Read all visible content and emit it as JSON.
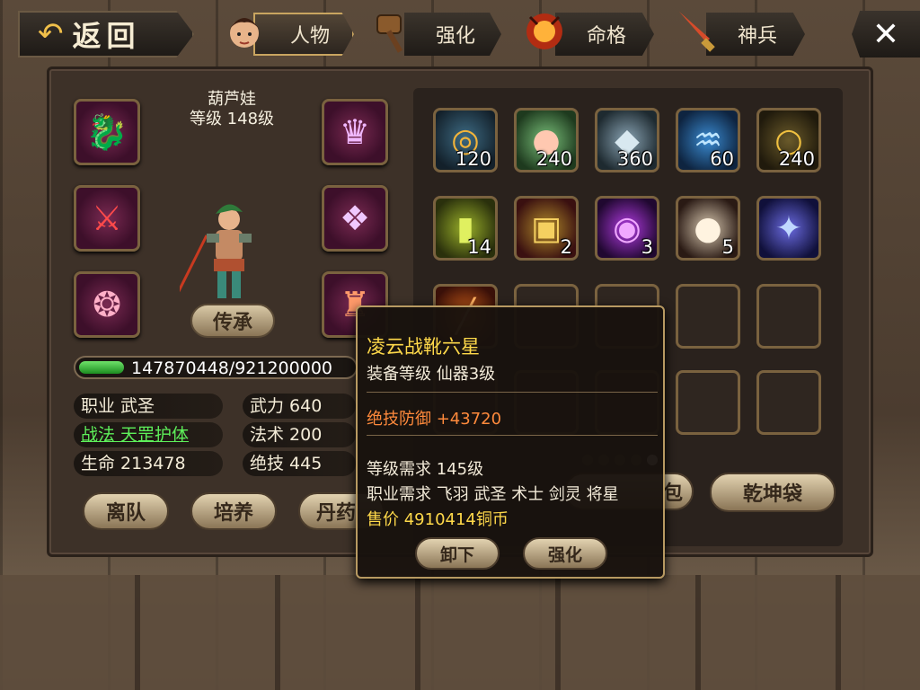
{
  "nav": {
    "back_label": "返回",
    "close_icon": "✕",
    "tabs": [
      {
        "label": "人物",
        "icon": "hero-portrait-icon",
        "active": true
      },
      {
        "label": "强化",
        "icon": "hammer-icon",
        "active": false
      },
      {
        "label": "命格",
        "icon": "demon-mask-icon",
        "active": false
      },
      {
        "label": "神兵",
        "icon": "sword-icon",
        "active": false
      }
    ]
  },
  "hero": {
    "name": "葫芦娃",
    "level_text": "等级 148级",
    "inherit_label": "传承",
    "exp_text": "147870448/921200000",
    "exp_fraction": 0.16,
    "stats_left": [
      {
        "text": "职业 武圣",
        "highlight": false
      },
      {
        "text": "战法 天罡护体",
        "highlight": true
      },
      {
        "text": "生命 213478",
        "highlight": false
      }
    ],
    "stats_right": [
      {
        "text": "武力 640"
      },
      {
        "text": "法术 200"
      },
      {
        "text": "绝技 445"
      }
    ],
    "buttons": [
      "离队",
      "培养",
      "丹药"
    ]
  },
  "equipment": [
    {
      "slot": "left-1",
      "icon": "white-beast-icon"
    },
    {
      "slot": "left-2",
      "icon": "red-blade-icon"
    },
    {
      "slot": "left-3",
      "icon": "pendant-icon"
    },
    {
      "slot": "right-1",
      "icon": "helmet-icon"
    },
    {
      "slot": "right-2",
      "icon": "armor-icon"
    },
    {
      "slot": "right-3",
      "icon": "boots-icon"
    }
  ],
  "bag": {
    "rows": [
      [
        {
          "icon": "gold-coin-icon",
          "count": "120"
        },
        {
          "icon": "peach-icon",
          "count": "240"
        },
        {
          "icon": "stone-icon",
          "count": "360"
        },
        {
          "icon": "water-icon",
          "count": "60"
        },
        {
          "icon": "ring-icon",
          "count": "240"
        }
      ],
      [
        {
          "icon": "jade-token-icon",
          "count": "14"
        },
        {
          "icon": "gold-talisman-icon",
          "count": "2"
        },
        {
          "icon": "purple-orb-icon",
          "count": "3"
        },
        {
          "icon": "bun-icon",
          "count": "5"
        },
        {
          "icon": "crystal-icon",
          "count": ""
        }
      ]
    ],
    "partial_item_icon": "scroll-icon",
    "page_count": 5,
    "active_page": 4,
    "button_partial": "包",
    "button_qiankun": "乾坤袋"
  },
  "tooltip": {
    "title": "凌云战靴六星",
    "equip_level": "装备等级 仙器3级",
    "bonus": "绝技防御 +43720",
    "level_req": "等级需求 145级",
    "class_req": "职业需求 飞羽 武圣 术士 剑灵 将星",
    "price": "售价 4910414铜币",
    "unequip_label": "卸下",
    "enhance_label": "强化"
  },
  "colors": {
    "gold_text": "#ffd94a",
    "bonus_text": "#ff8a3c",
    "green_text": "#5ef05a",
    "exp_fill": "#2fb82c"
  }
}
